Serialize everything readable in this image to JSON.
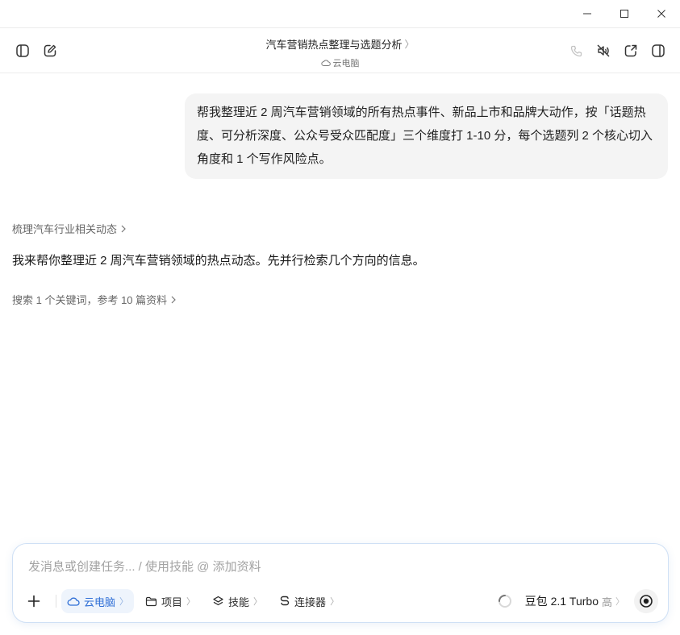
{
  "window": {
    "minimize_icon": "minimize-icon",
    "maximize_icon": "maximize-icon",
    "close_icon": "close-icon"
  },
  "header": {
    "title": "汽车营销热点整理与选题分析",
    "title_chevron": "〉",
    "subtitle": "云电脑",
    "left_icons": [
      "sidebar-toggle-icon",
      "new-chat-icon"
    ],
    "right_icons": [
      "phone-icon",
      "mute-icon",
      "share-icon",
      "panel-icon"
    ]
  },
  "conversation": {
    "user_message": "帮我整理近 2 周汽车营销领域的所有热点事件、新品上市和品牌大动作，按「话题热度、可分析深度、公众号受众匹配度」三个维度打 1-10 分，每个选题列 2 个核心切入角度和 1 个写作风险点。",
    "task_link": "梳理汽车行业相关动态",
    "reply": "我来帮你整理近 2 周汽车营销领域的热点动态。先并行检索几个方向的信息。",
    "search_summary": "搜索 1 个关键词，参考 10 篇资料"
  },
  "composer": {
    "placeholder": "发消息或创建任务... / 使用技能 @ 添加资料",
    "value": "",
    "chips": {
      "cloud": "云电脑",
      "project": "项目",
      "skills": "技能",
      "connectors": "连接器"
    },
    "chevron": "〉",
    "model_name": "豆包 2.1 Turbo",
    "model_level": "高"
  },
  "colors": {
    "accent": "#2f6fd6",
    "bubble_bg": "#f4f4f4",
    "composer_border": "#cfe0f5"
  }
}
